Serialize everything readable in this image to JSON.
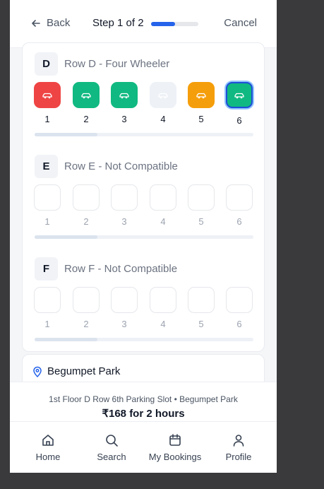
{
  "header": {
    "back_label": "Back",
    "step_label": "Step 1 of 2",
    "progress_fraction": 0.5,
    "cancel_label": "Cancel"
  },
  "rows": [
    {
      "letter": "D",
      "title": "Row D - Four Wheeler",
      "slots": [
        {
          "number": "1",
          "status": "occupied",
          "color": "#ef4444"
        },
        {
          "number": "2",
          "status": "available",
          "color": "#10b981"
        },
        {
          "number": "3",
          "status": "available",
          "color": "#10b981"
        },
        {
          "number": "4",
          "status": "unavailable",
          "color": "#eef1f6"
        },
        {
          "number": "5",
          "status": "reserved",
          "color": "#f59e0b"
        },
        {
          "number": "6",
          "status": "selected",
          "color": "#10b981"
        }
      ]
    },
    {
      "letter": "E",
      "title": "Row E - Not Compatible",
      "slots": [
        {
          "number": "1",
          "status": "incompatible"
        },
        {
          "number": "2",
          "status": "incompatible"
        },
        {
          "number": "3",
          "status": "incompatible"
        },
        {
          "number": "4",
          "status": "incompatible"
        },
        {
          "number": "5",
          "status": "incompatible"
        },
        {
          "number": "6",
          "status": "incompatible"
        }
      ]
    },
    {
      "letter": "F",
      "title": "Row F - Not Compatible",
      "slots": [
        {
          "number": "1",
          "status": "incompatible"
        },
        {
          "number": "2",
          "status": "incompatible"
        },
        {
          "number": "3",
          "status": "incompatible"
        },
        {
          "number": "4",
          "status": "incompatible"
        },
        {
          "number": "5",
          "status": "incompatible"
        },
        {
          "number": "6",
          "status": "incompatible"
        }
      ]
    }
  ],
  "location": {
    "icon": "map-pin-icon",
    "name": "Begumpet Park"
  },
  "summary": {
    "description": "1st Floor D Row 6th Parking Slot • Begumpet Park",
    "price": "₹168 for 2 hours"
  },
  "nav": [
    {
      "label": "Home",
      "icon": "home-icon"
    },
    {
      "label": "Search",
      "icon": "search-icon"
    },
    {
      "label": "My Bookings",
      "icon": "calendar-icon"
    },
    {
      "label": "Profile",
      "icon": "user-icon"
    }
  ],
  "colors": {
    "accent": "#2563eb",
    "available": "#10b981",
    "occupied": "#ef4444",
    "reserved": "#f59e0b"
  }
}
